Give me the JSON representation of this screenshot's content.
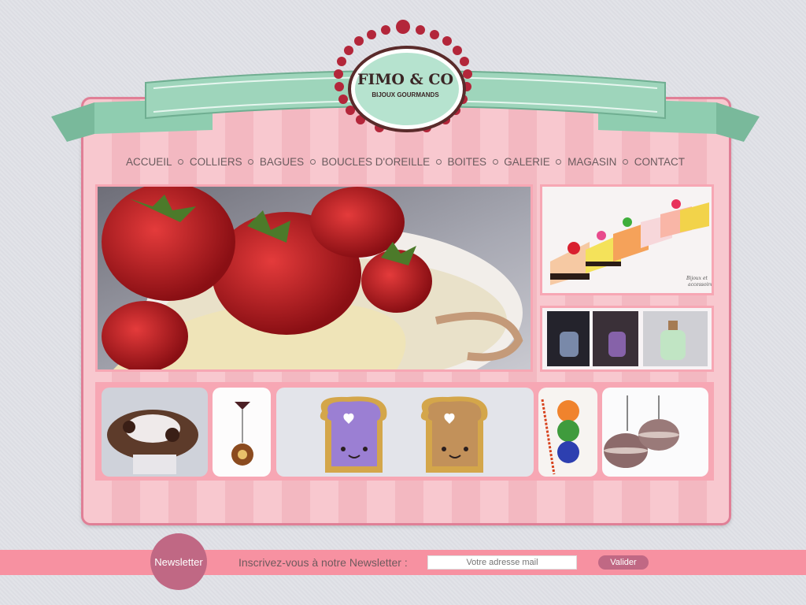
{
  "logo": {
    "title": "FIMO & CO",
    "subtitle": "BIJOUX GOURMANDS"
  },
  "nav": {
    "items": [
      "Accueil",
      "Colliers",
      "Bagues",
      "Boucles d'oreille",
      "Boites",
      "Galerie",
      "Magasin",
      "Contact"
    ]
  },
  "watermark": {
    "line1": "Bijoux et",
    "line2": "accessoires"
  },
  "newsletter": {
    "badge": "Newsletter",
    "label": "Inscrivez-vous à notre Newsletter :",
    "placeholder": "Votre adresse mail",
    "button": "Valider"
  },
  "colors": {
    "panel_pink": "#f8c8cf",
    "frame_pink": "#f7a7b4",
    "ribbon_green": "#8fcdb0",
    "logo_mint": "#b6e3cf",
    "accent_rose": "#c06884"
  }
}
